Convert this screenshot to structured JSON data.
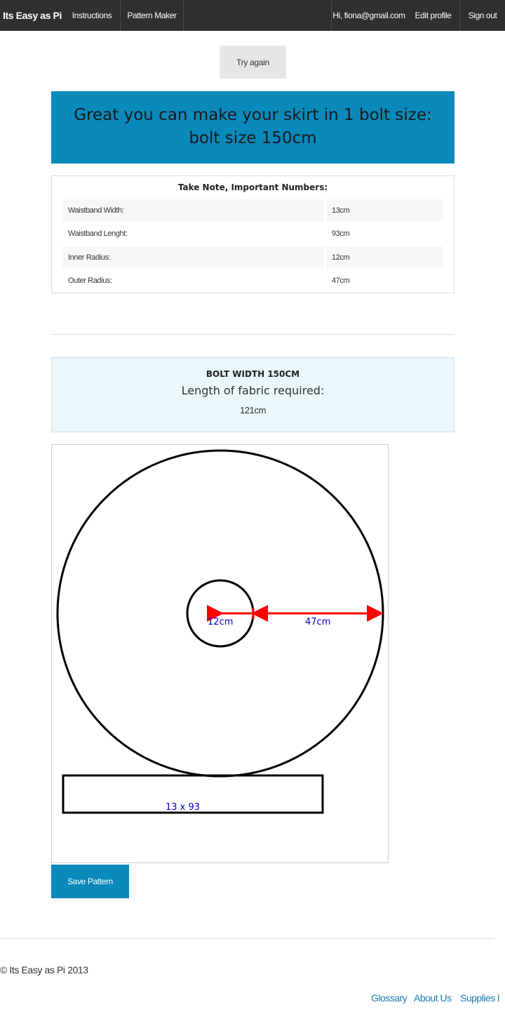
{
  "nav": {
    "brand": "Its Easy as Pi",
    "instructions": "Instructions",
    "pattern_maker": "Pattern Maker",
    "greeting": "Hi, fiona@gmail.com",
    "edit_profile": "Edit profile",
    "sign_out": "Sign out"
  },
  "try_again_label": "Try again",
  "banner_text": "Great you can make your skirt in 1 bolt size: bolt size 150cm",
  "notes": {
    "title": "Take Note, Important Numbers:",
    "rows": [
      {
        "label": "Waistband Width:",
        "value": "13cm"
      },
      {
        "label": "Waistband Lenght:",
        "value": "93cm"
      },
      {
        "label": "Inner Radius:",
        "value": "12cm"
      },
      {
        "label": "Outer Radius:",
        "value": "47cm"
      }
    ]
  },
  "bolt": {
    "heading": "BOLT WIDTH 150CM",
    "subheading": "Length of fabric required:",
    "length": "121cm"
  },
  "diagram": {
    "inner_radius_label": "12cm",
    "outer_radius_label": "47cm",
    "waistband_label": "13 x 93",
    "arrow_color": "#ff0000",
    "label_color": "#0000cc"
  },
  "save_label": "Save Pattern",
  "footer": {
    "copyright": "© Its Easy as Pi 2013",
    "links": [
      "Glossary",
      "About Us",
      "Supplies l"
    ]
  },
  "colors": {
    "navbar": "#2f2f2f",
    "accent": "#0a89bb",
    "info_bg": "#eaf7fb",
    "link": "#1b7ab0"
  }
}
